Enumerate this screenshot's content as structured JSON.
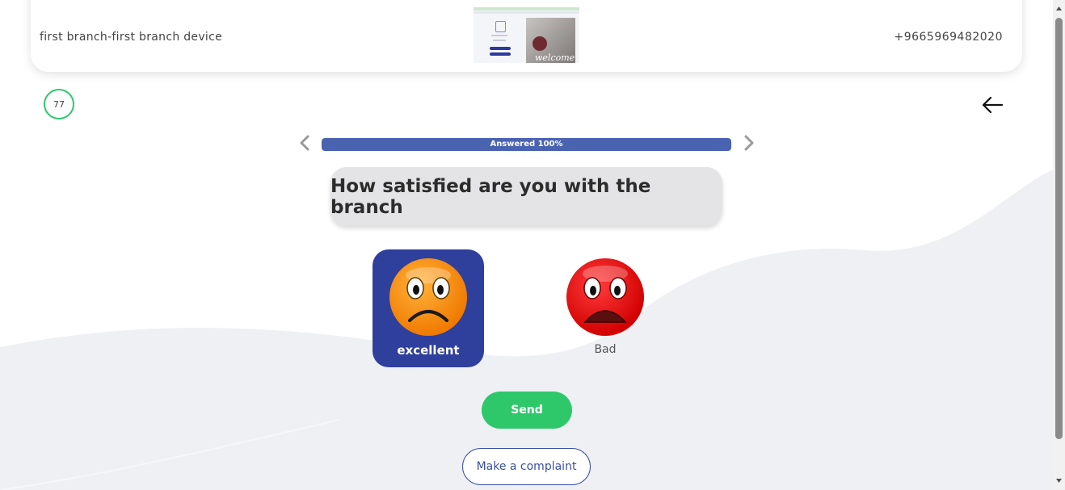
{
  "header": {
    "device_name": "first branch-first branch device",
    "phone": "+9665969482020",
    "thumbnail_text": "welcome"
  },
  "counter": {
    "value": "77"
  },
  "progress": {
    "label": "Answered 100%",
    "percent": 100
  },
  "question": {
    "text": "How satisfied are you with the branch"
  },
  "options": [
    {
      "label": "excellent",
      "face": "frowning-orange-emoji",
      "selected": true
    },
    {
      "label": "Bad",
      "face": "angry-red-emoji",
      "selected": false
    }
  ],
  "actions": {
    "send_label": "Send",
    "complaint_label": "Make a complaint"
  },
  "colors": {
    "accent_blue": "#2f3f9c",
    "progress_blue": "#4a63b1",
    "send_green": "#2ec86b",
    "wave_gray": "#eef0f4"
  }
}
